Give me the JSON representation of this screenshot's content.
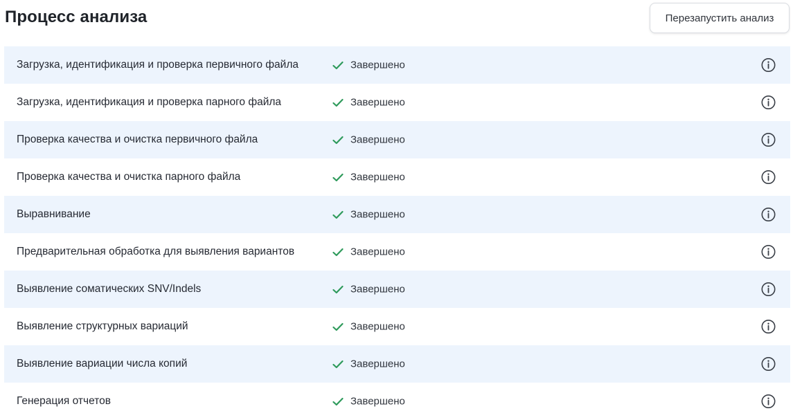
{
  "header": {
    "title": "Процесс анализа",
    "restart_label": "Перезапустить анализ"
  },
  "colors": {
    "row_highlight": "#edf4fd",
    "check_green": "#2e9a5b",
    "info_icon": "#3a3f47"
  },
  "icons": {
    "status": "check-icon",
    "details": "info-icon"
  },
  "steps": [
    {
      "name": "Загрузка, идентификация и проверка первичного файла",
      "status": "Завершено"
    },
    {
      "name": "Загрузка, идентификация и проверка парного файла",
      "status": "Завершено"
    },
    {
      "name": "Проверка качества и очистка первичного файла",
      "status": "Завершено"
    },
    {
      "name": "Проверка качества и очистка парного файла",
      "status": "Завершено"
    },
    {
      "name": "Выравнивание",
      "status": "Завершено"
    },
    {
      "name": "Предварительная обработка для выявления вариантов",
      "status": "Завершено"
    },
    {
      "name": "Выявление соматических SNV/Indels",
      "status": "Завершено"
    },
    {
      "name": "Выявление структурных вариаций",
      "status": "Завершено"
    },
    {
      "name": "Выявление вариации числа копий",
      "status": "Завершено"
    },
    {
      "name": "Генерация отчетов",
      "status": "Завершено"
    }
  ]
}
